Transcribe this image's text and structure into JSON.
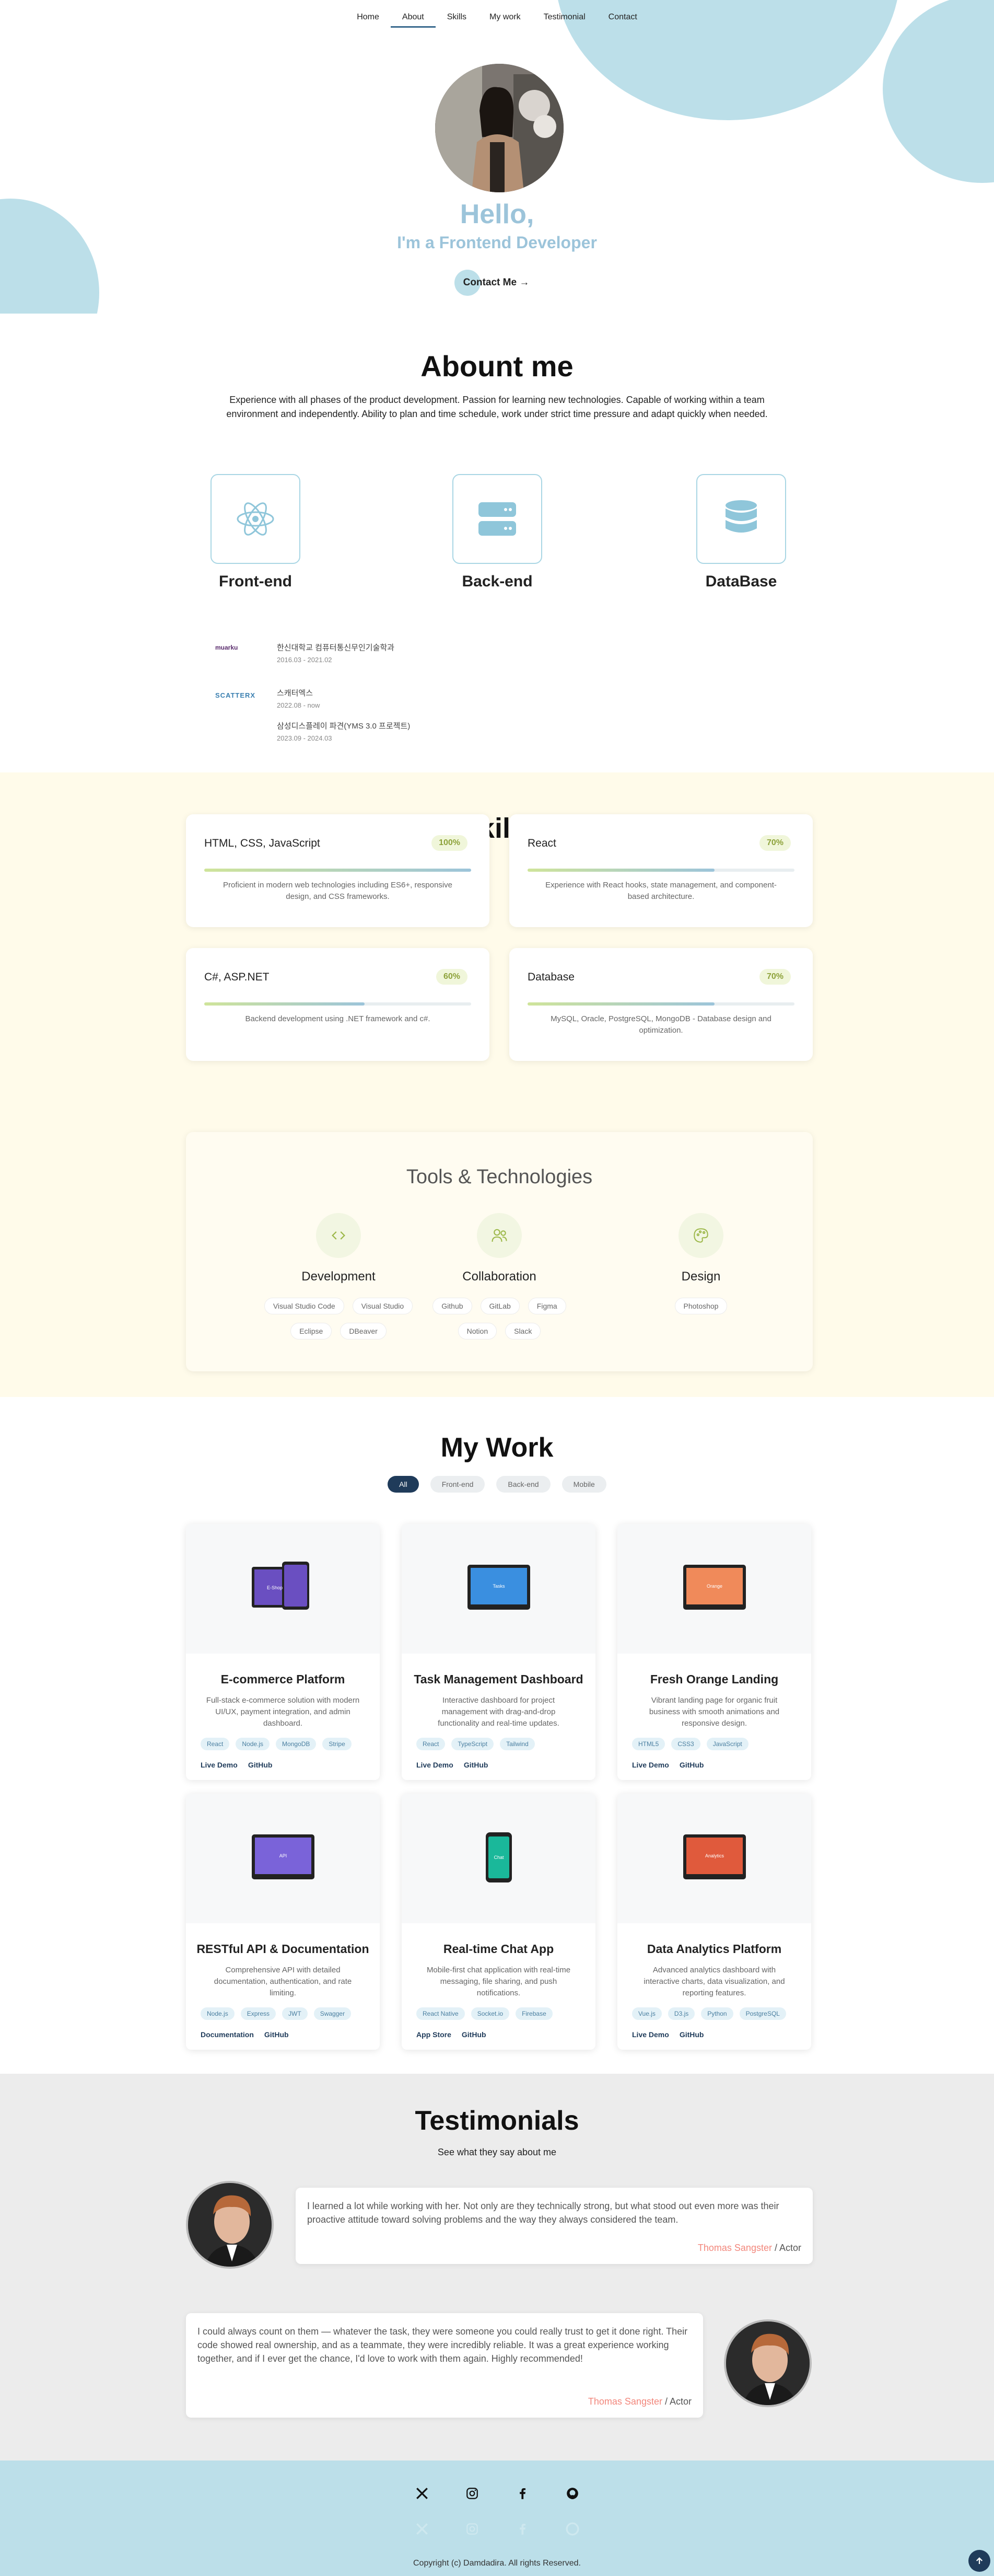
{
  "nav": {
    "items": [
      "Home",
      "About",
      "Skills",
      "My work",
      "Testimonial",
      "Contact"
    ],
    "active": "About"
  },
  "hero": {
    "hello": "Hello,",
    "subtitle": "I'm a Frontend Developer",
    "button_label": "Contact Me →"
  },
  "about": {
    "title": "Abount me",
    "paragraph": "Experience with all phases of the product development. Passion for learning new technologies. Capable of working within a team environment and independently. Ability to plan and time schedule, work under strict time pressure and adapt quickly when needed.",
    "areas": [
      "Front-end",
      "Back-end",
      "DataBase"
    ],
    "education": [
      {
        "logo": "muarku",
        "title": "한신대학교 컴퓨터통신무인기술학과",
        "date": "2016.03 - 2021.02"
      },
      {
        "logo": "SCATTERX",
        "title": "스캐터엑스",
        "date": "2022.08 - now"
      },
      {
        "logo": "",
        "title": "삼성디스플레이 파견(YMS 3.0 프로젝트)",
        "date": "2023.09 - 2024.03"
      }
    ]
  },
  "skills": {
    "title": "Skills",
    "cards": [
      {
        "name": "HTML, CSS, JavaScript",
        "percent": 100,
        "percent_label": "100%",
        "desc": "Proficient in modern web technologies including ES6+, responsive design, and CSS frameworks."
      },
      {
        "name": "React",
        "percent": 70,
        "percent_label": "70%",
        "desc": "Experience with React hooks, state management, and component-based architecture."
      },
      {
        "name": "C#, ASP.NET",
        "percent": 60,
        "percent_label": "60%",
        "desc": "Backend development using .NET framework and c#."
      },
      {
        "name": "Database",
        "percent": 70,
        "percent_label": "70%",
        "desc": "MySQL, Oracle, PostgreSQL, MongoDB - Database design and optimization."
      }
    ],
    "tools_title": "Tools & Technologies",
    "tools": [
      {
        "name": "Development",
        "icon": "code-icon",
        "chips": [
          "Visual Studio Code",
          "Visual Studio",
          "Eclipse",
          "DBeaver"
        ]
      },
      {
        "name": "Collaboration",
        "icon": "users-icon",
        "chips": [
          "Github",
          "GitLab",
          "Figma",
          "Notion",
          "Slack"
        ]
      },
      {
        "name": "Design",
        "icon": "palette-icon",
        "chips": [
          "Photoshop"
        ]
      }
    ]
  },
  "work": {
    "title": "My Work",
    "filters": [
      "All",
      "Front-end",
      "Back-end",
      "Mobile"
    ],
    "active_filter": "All",
    "projects": [
      {
        "title": "E-commerce Platform",
        "desc": "Full-stack e-commerce solution with modern UI/UX, payment integration, and admin dashboard.",
        "tags": [
          "React",
          "Node.js",
          "MongoDB",
          "Stripe"
        ],
        "links": [
          "Live Demo",
          "GitHub"
        ],
        "screen_text": "E-Shop",
        "screen_color": "#6a4fc1"
      },
      {
        "title": "Task Management Dashboard",
        "desc": "Interactive dashboard for project management with drag-and-drop functionality and real-time updates.",
        "tags": [
          "React",
          "TypeScript",
          "Tailwind"
        ],
        "links": [
          "Live Demo",
          "GitHub"
        ],
        "screen_text": "Tasks",
        "screen_color": "#3a8fe0"
      },
      {
        "title": "Fresh Orange Landing",
        "desc": "Vibrant landing page for organic fruit business with smooth animations and responsive design.",
        "tags": [
          "HTML5",
          "CSS3",
          "JavaScript"
        ],
        "links": [
          "Live Demo",
          "GitHub"
        ],
        "screen_text": "Orange",
        "screen_color": "#f08a5a"
      },
      {
        "title": "RESTful API & Documentation",
        "desc": "Comprehensive API with detailed documentation, authentication, and rate limiting.",
        "tags": [
          "Node.js",
          "Express",
          "JWT",
          "Swagger"
        ],
        "links": [
          "Documentation",
          "GitHub"
        ],
        "screen_text": "API",
        "screen_color": "#7a63d9"
      },
      {
        "title": "Real-time Chat App",
        "desc": "Mobile-first chat application with real-time messaging, file sharing, and push notifications.",
        "tags": [
          "React Native",
          "Socket.io",
          "Firebase"
        ],
        "links": [
          "App Store",
          "GitHub"
        ],
        "screen_text": "Chat",
        "screen_color": "#1ab89a"
      },
      {
        "title": "Data Analytics Platform",
        "desc": "Advanced analytics dashboard with interactive charts, data visualization, and reporting features.",
        "tags": [
          "Vue.js",
          "D3.js",
          "Python",
          "PostgreSQL"
        ],
        "links": [
          "Live Demo",
          "GitHub"
        ],
        "screen_text": "Analytics",
        "screen_color": "#e05a3c"
      }
    ]
  },
  "testimonials": {
    "title": "Testimonials",
    "subtitle": "See what they say about me",
    "items": [
      {
        "text": "I learned a lot while working with her. Not only are they technically strong, but what stood out even more was their proactive attitude toward solving problems and the way they always considered the team.",
        "author": "Thomas Sangster",
        "role": " / Actor"
      },
      {
        "text": "I could always count on them — whatever the task, they were someone you could really trust to get it done right. Their code showed real ownership, and as a teammate, they were incredibly reliable. It was a great experience working together, and if I ever get the chance, I'd love to work with them again. Highly recommended!",
        "author": "Thomas Sangster",
        "role": " / Actor"
      }
    ]
  },
  "footer": {
    "icons": [
      "x-icon",
      "instagram-icon",
      "facebook-icon",
      "github-icon"
    ],
    "copyright": "Copyright (c) Damdadira. All rights Reserved."
  },
  "colors": {
    "accent": "#bcdfe9",
    "hero_text": "#9cc4da",
    "navy": "#1f3b5a",
    "skills_bg": "#fffbea",
    "testimonial_bg": "#ececec",
    "author": "#f2877c"
  }
}
